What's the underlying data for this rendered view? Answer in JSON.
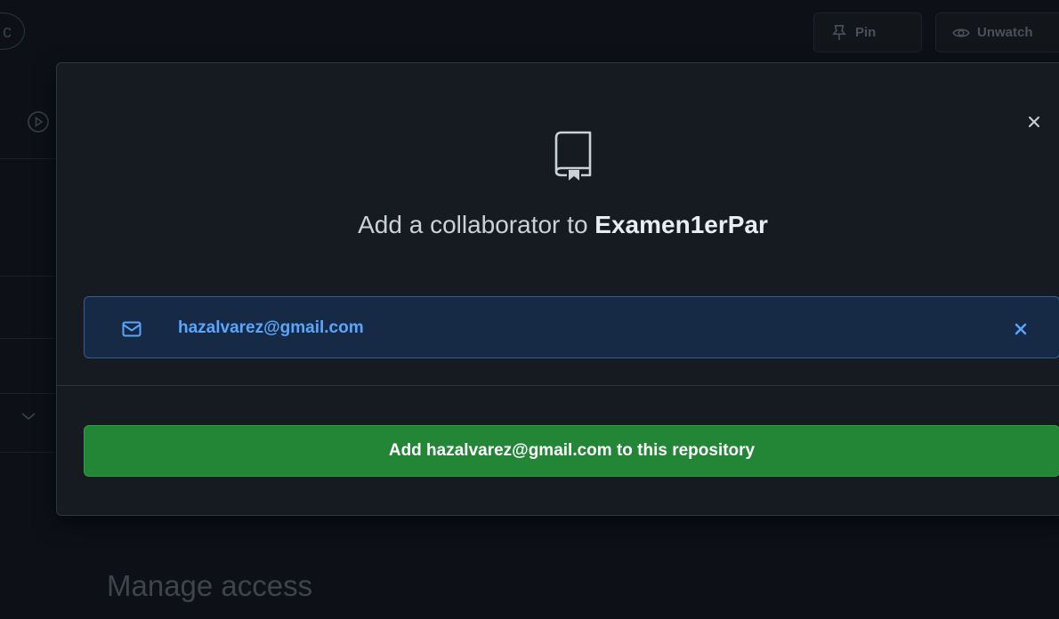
{
  "background": {
    "pin_label": "Pin",
    "unwatch_label": "Unwatch",
    "manage_access_heading": "Manage access",
    "top_left_fragment": "c"
  },
  "modal": {
    "title_prefix": "Add a collaborator to ",
    "repo_name": "Examen1erPar",
    "selected_email": "hazalvarez@gmail.com",
    "add_button_label": "Add hazalvarez@gmail.com to this repository",
    "icons": {
      "header": "repo-icon",
      "close": "close-icon",
      "email": "mail-icon",
      "remove": "remove-x-icon"
    }
  },
  "colors": {
    "page_bg": "#0d1117",
    "modal_bg": "#161b22",
    "accent_blue": "#58a6ff",
    "selected_bg": "#172a45",
    "button_green": "#238636"
  }
}
